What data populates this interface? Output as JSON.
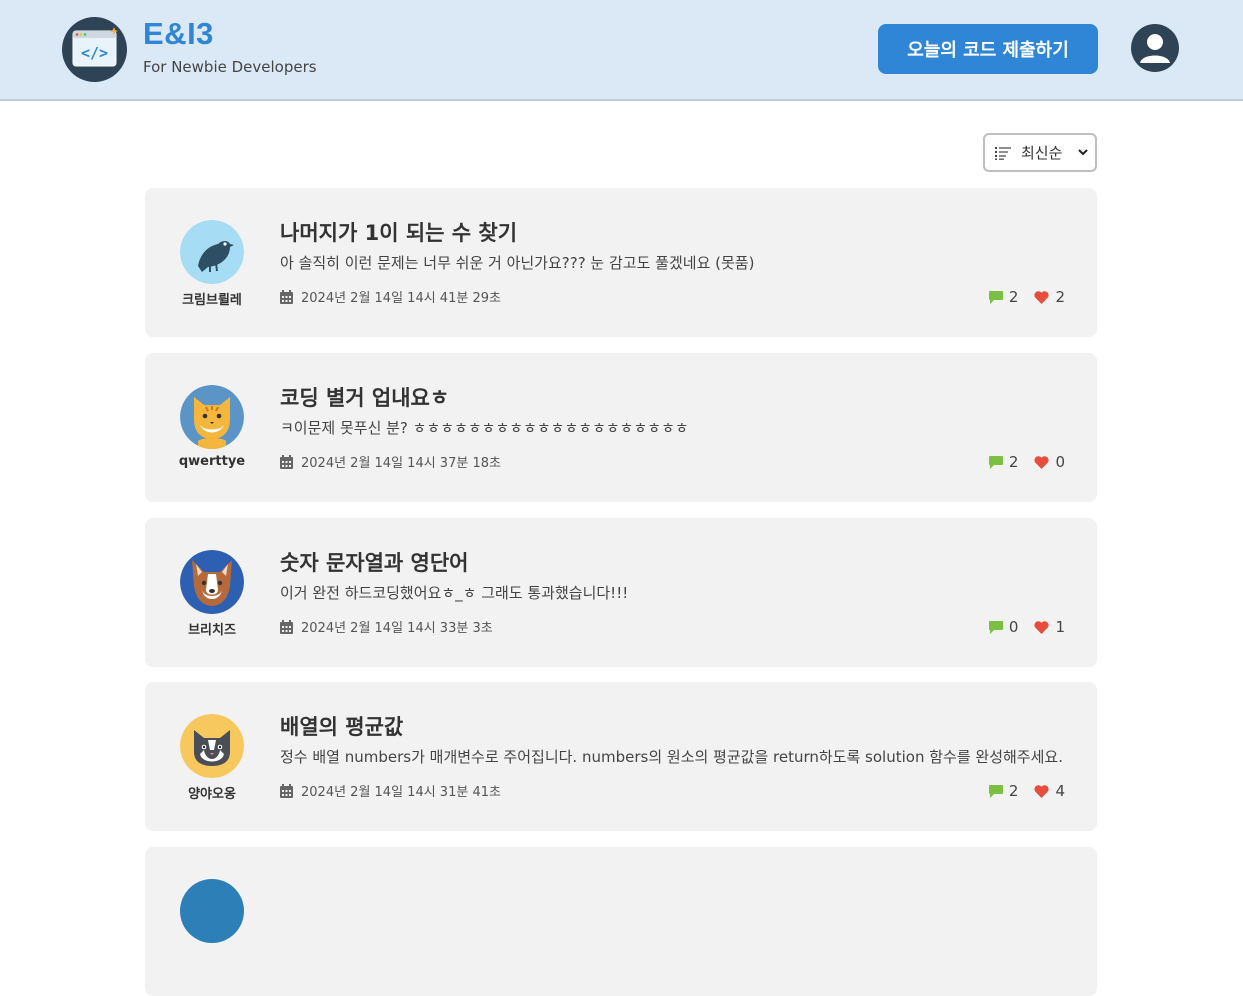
{
  "brand": {
    "title": "E&I3",
    "subtitle": "For Newbie Developers"
  },
  "header": {
    "submit_label": "오늘의 코드 제출하기"
  },
  "sort": {
    "selected": "최신순"
  },
  "colors": {
    "accent": "#2f86d6",
    "header_bg": "#dbe9f7",
    "comment": "#7bc043",
    "heart": "#e74c3c"
  },
  "posts": [
    {
      "author": "크림브륄레",
      "avatar_icon": "bird-avatar-icon",
      "title": "나머지가 1이 되는 수 찾기",
      "snippet": "아 솔직히 이런 문제는 너무 쉬운 거 아닌가요??? 눈 감고도 풀겠네요 (못품)",
      "date": "2024년 2월 14일 14시 41분 29초",
      "comments": "2",
      "likes": "2"
    },
    {
      "author": "qwerttye",
      "avatar_icon": "tiger-avatar-icon",
      "title": "코딩 별거 업내요ㅎ",
      "snippet": "ㅋ이문제 못푸신 분? ㅎㅎㅎㅎㅎㅎㅎㅎㅎㅎㅎㅎㅎㅎㅎㅎㅎㅎㅎㅎ",
      "date": "2024년 2월 14일 14시 37분 18초",
      "comments": "2",
      "likes": "0"
    },
    {
      "author": "브리치즈",
      "avatar_icon": "dog-avatar-icon",
      "title": "숫자 문자열과 영단어",
      "snippet": "이거 완전 하드코딩했어요ㅎ_ㅎ 그래도 통과했습니다!!!",
      "date": "2024년 2월 14일 14시 33분 3초",
      "comments": "0",
      "likes": "1"
    },
    {
      "author": "양야오옹",
      "avatar_icon": "cat-avatar-icon",
      "title": "배열의 평균값",
      "snippet": "정수 배열 numbers가 매개변수로 주어집니다. numbers의 원소의 평균값을 return하도록 solution 함수를 완성해주세요.",
      "date": "2024년 2월 14일 14시 31분 41초",
      "comments": "2",
      "likes": "4"
    }
  ]
}
